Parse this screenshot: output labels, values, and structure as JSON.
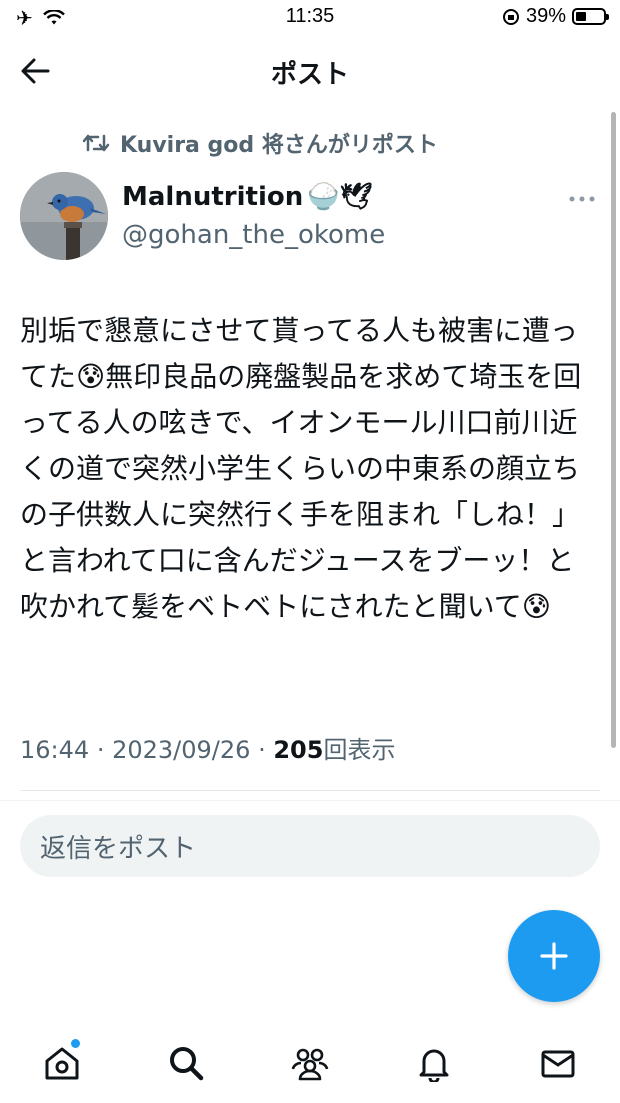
{
  "status_bar": {
    "time": "11:35",
    "battery_percent": "39%",
    "battery_level": 0.39
  },
  "header": {
    "title": "ポスト"
  },
  "repost": {
    "label": "Kuvira god 将さんがリポスト"
  },
  "author": {
    "display_name": "Malnutrition",
    "name_emojis": "🍚🕊",
    "handle": "@gohan_the_okome"
  },
  "tweet": {
    "text": "別垢で懇意にさせて貰ってる人も被害に遭ってた😰無印良品の廃盤製品を求めて埼玉を回ってる人の呟きで、イオンモール川口前川近くの道で突然小学生くらいの中東系の顔立ちの子供数人に突然行く手を阻まれ「しね！」と言われて口に含んだジュースをブーッ！と吹かれて髪をベトベトにされたと聞いて😰",
    "time": "16:44",
    "separator": "·",
    "date": "2023/09/26",
    "views_count": "205",
    "views_label": "回表示"
  },
  "reply": {
    "placeholder": "返信をポスト"
  },
  "icons": {
    "back": "back-arrow-icon",
    "repost": "repost-icon",
    "more": "more-icon",
    "compose": "plus-icon",
    "home": "home-icon",
    "search": "search-icon",
    "communities": "communities-icon",
    "notifications": "bell-icon",
    "messages": "mail-icon"
  },
  "colors": {
    "accent": "#1d9bf0",
    "secondary_text": "#536471",
    "primary_text": "#0f1419"
  }
}
